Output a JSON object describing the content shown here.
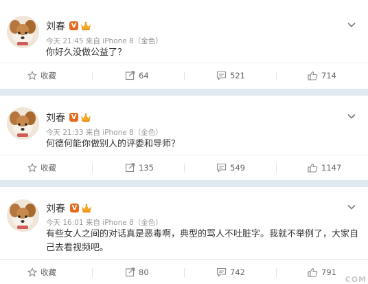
{
  "posts": [
    {
      "author": "刘春",
      "verified_badge": "V",
      "time": "今天 21:45 来自 iPhone 8（金色）",
      "content": "你好久没做公益了？",
      "actions": {
        "favorite": "收藏",
        "repost": "64",
        "comment": "521",
        "like": "714"
      }
    },
    {
      "author": "刘春",
      "verified_badge": "V",
      "time": "今天 21:33 来自 iPhone 8（金色）",
      "content": "何德何能你做别人的评委和导师？",
      "actions": {
        "favorite": "收藏",
        "repost": "135",
        "comment": "549",
        "like": "1147"
      }
    },
    {
      "author": "刘春",
      "verified_badge": "V",
      "time": "今天 16:01 来自 iPhone 8（金色）",
      "content": "有些女人之间的对话真是恶毒啊，典型的骂人不吐脏字。我就不举例了，大家自己去看视频吧。",
      "actions": {
        "favorite": "收藏",
        "repost": "80",
        "comment": "742",
        "like": "791"
      }
    }
  ],
  "watermark": "COM",
  "colors": {
    "separator": "#dfe9f0",
    "verified": "#e56a1f",
    "crown": "#f5a623",
    "meta": "#999999"
  },
  "icons": [
    "avatar-dog",
    "verified-v-icon",
    "vip-crown-icon",
    "chevron-down-icon",
    "star-icon",
    "repost-icon",
    "comment-icon",
    "thumbs-up-icon"
  ]
}
